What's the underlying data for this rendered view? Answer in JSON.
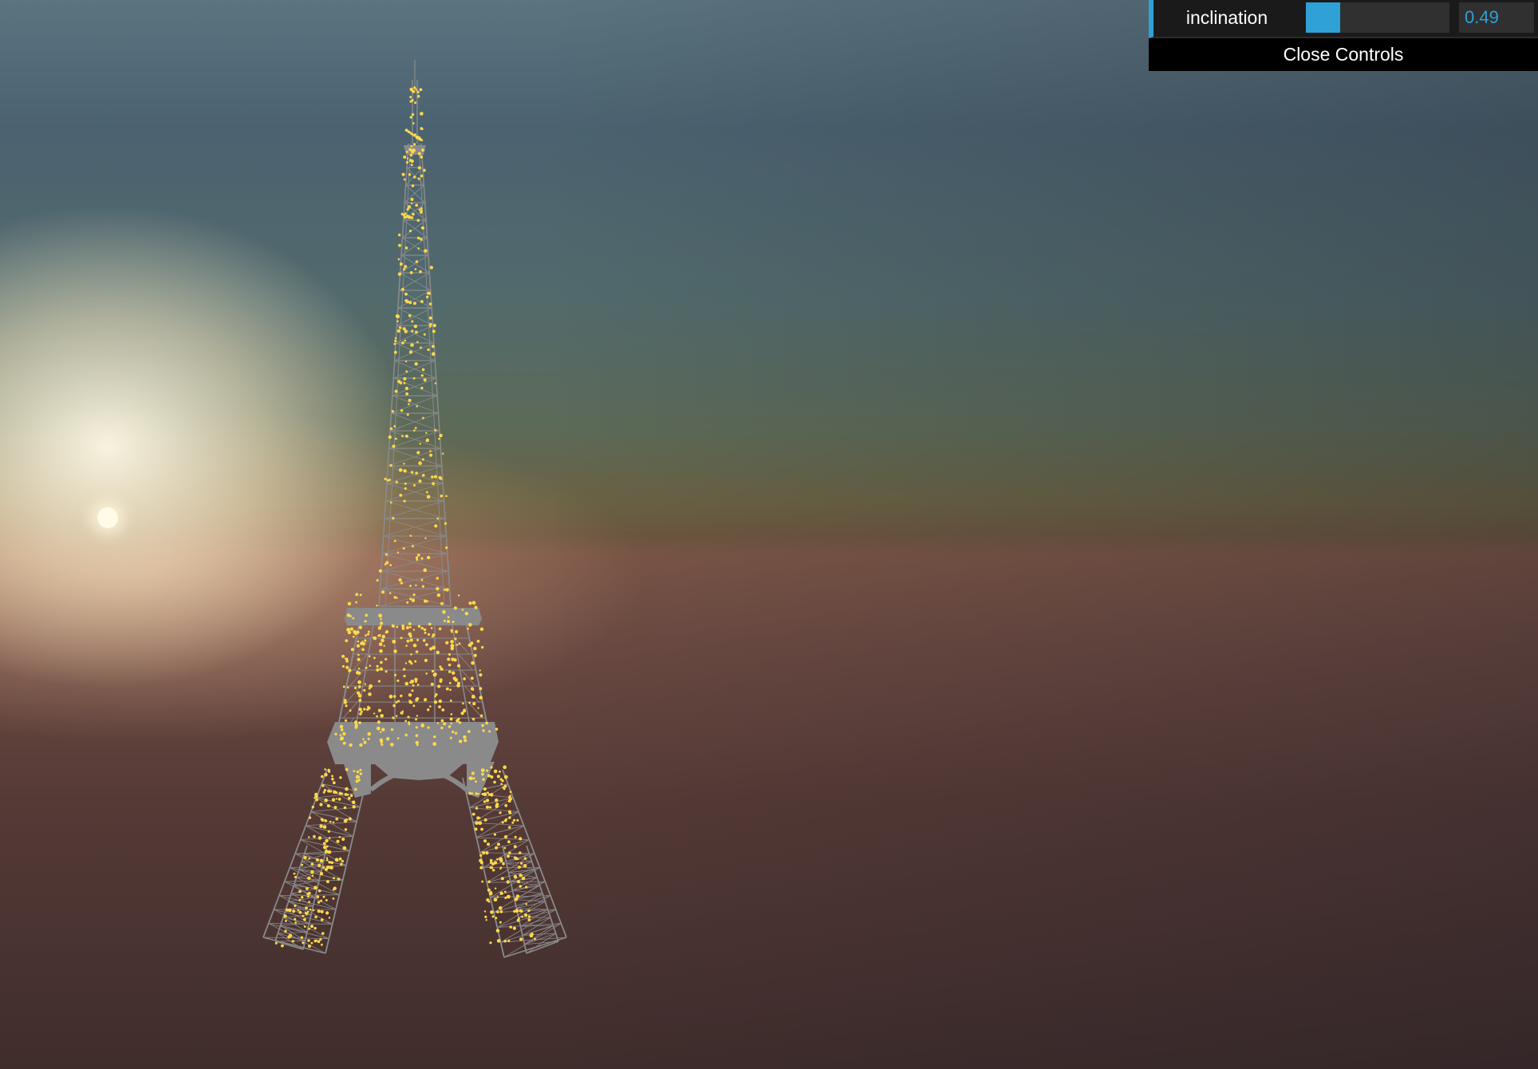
{
  "controls": {
    "parameters": [
      {
        "label": "inclination",
        "value": "0.49",
        "slider_fill_fraction": 0.24
      }
    ],
    "close_label": "Close Controls"
  },
  "scene": {
    "colors": {
      "tower": "#8a8a8a",
      "sparkle": "#ffd84a",
      "accent": "#2fa1d6"
    }
  }
}
